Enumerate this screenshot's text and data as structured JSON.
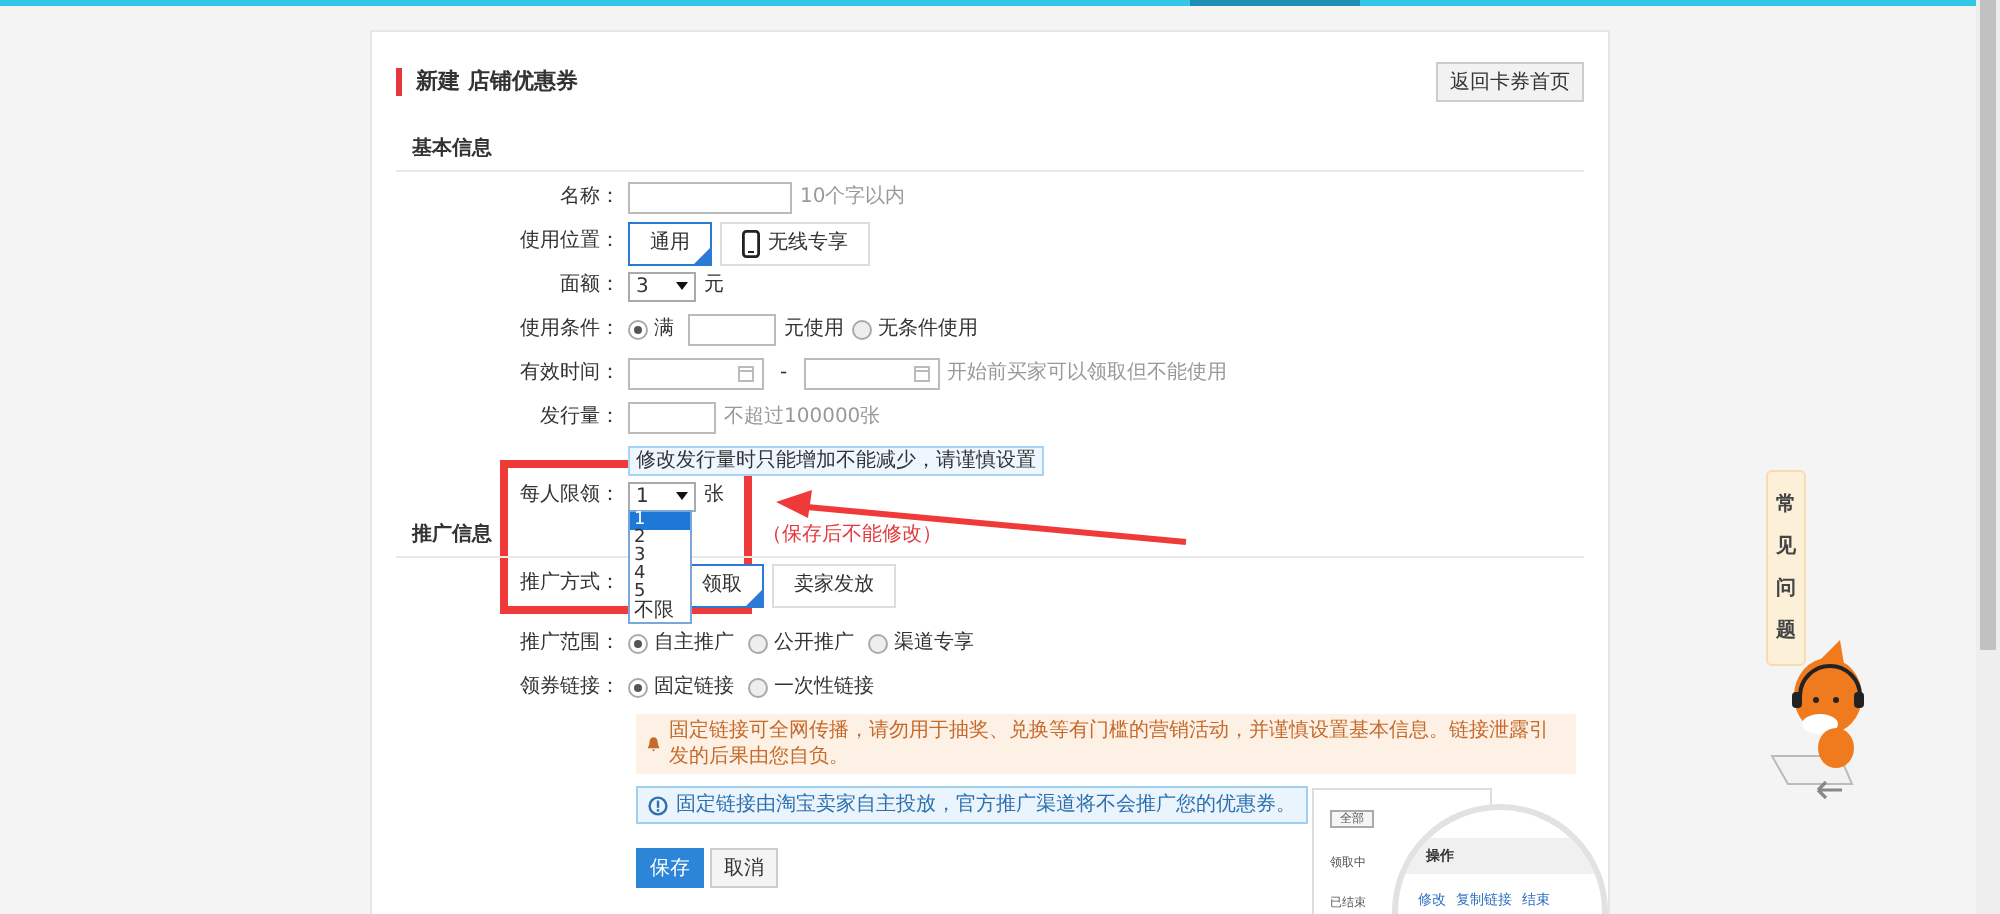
{
  "title": "新建 店铺优惠券",
  "back_button": "返回卡券首页",
  "basic_info": {
    "title": "基本信息",
    "fields": [
      {
        "kind": "text",
        "label": "名称：",
        "hint": "10个字以内"
      },
      {
        "kind": "toggle",
        "label": "使用位置：",
        "options": [
          {
            "label": "通用",
            "kind": "plain",
            "selected": true
          },
          {
            "label": "无线专享",
            "kind": "mobile",
            "selected": false
          }
        ]
      },
      {
        "kind": "select",
        "label": "面额：",
        "value": "3",
        "unit": "元"
      },
      {
        "kind": "condition",
        "label": "使用条件：",
        "unit": "元使用",
        "options": [
          {
            "label": "满",
            "selected": true
          },
          {
            "label": "无条件使用",
            "selected": false
          }
        ]
      },
      {
        "kind": "daterange",
        "label": "有效时间：",
        "separator": "-",
        "hint": "开始前买家可以领取但不能使用"
      },
      {
        "kind": "text",
        "label": "发行量：",
        "hint": "不超过100000张",
        "note": "修改发行量时只能增加不能减少，请谨慎设置"
      },
      {
        "kind": "select",
        "label": "每人限领：",
        "value": "1",
        "unit": "张",
        "expanded": true,
        "options": [
          {
            "label": "1",
            "selected": true
          },
          {
            "label": "2",
            "selected": false
          },
          {
            "label": "3",
            "selected": false
          },
          {
            "label": "4",
            "selected": false
          },
          {
            "label": "5",
            "selected": false
          },
          {
            "label": "不限",
            "selected": false
          }
        ]
      }
    ]
  },
  "promotion": {
    "title": "推广信息",
    "note": "（保存后不能修改）",
    "fields": [
      {
        "kind": "toggle",
        "label": "推广方式：",
        "options": [
          {
            "label": "领取",
            "selected": true
          },
          {
            "label": "卖家发放",
            "selected": false
          }
        ]
      },
      {
        "kind": "radio",
        "label": "推广范围：",
        "options": [
          {
            "label": "自主推广",
            "selected": true
          },
          {
            "label": "公开推广",
            "selected": false
          },
          {
            "label": "渠道专享",
            "selected": false
          }
        ]
      },
      {
        "kind": "radio",
        "label": "领券链接：",
        "options": [
          {
            "label": "固定链接",
            "selected": true
          },
          {
            "label": "一次性链接",
            "selected": false
          }
        ]
      }
    ],
    "alerts": [
      {
        "kind": "warning",
        "text": "固定链接可全网传播，请勿用于抽奖、兑换等有门槛的营销活动，并谨慎设置基本信息。链接泄露引发的后果由您自负。"
      },
      {
        "kind": "info",
        "text": "固定链接由淘宝卖家自主投放，官方推广渠道将不会推广您的优惠券。"
      }
    ]
  },
  "actions": [
    {
      "label": "保存",
      "kind": "primary"
    },
    {
      "label": "取消",
      "kind": "default"
    }
  ],
  "illustration": {
    "filter": "全部",
    "column": "操作",
    "rows": [
      "领取中",
      "已结束"
    ],
    "links": [
      "修改",
      "复制链接",
      "结束"
    ]
  },
  "help": {
    "label": "常见问题"
  }
}
